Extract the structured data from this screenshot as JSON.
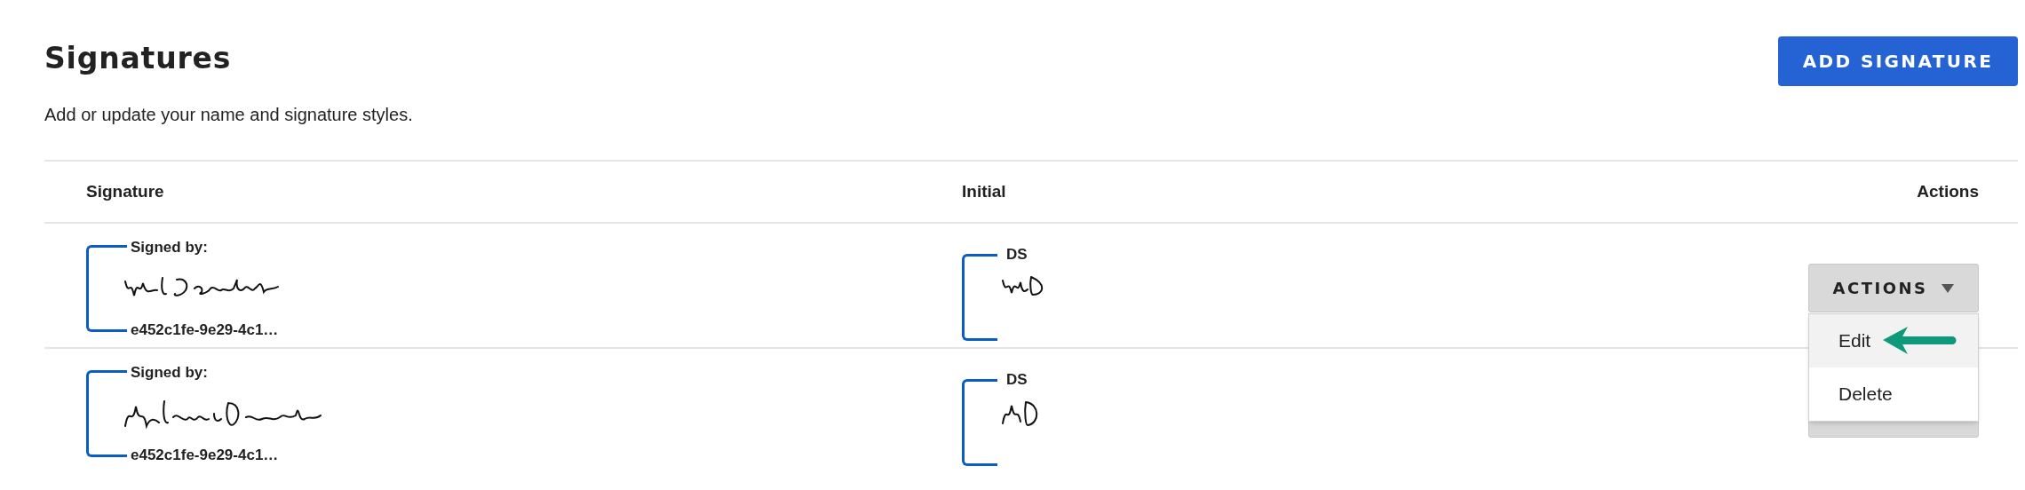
{
  "page": {
    "title": "Signatures",
    "subtitle": "Add or update your name and signature styles.",
    "add_button": "ADD SIGNATURE"
  },
  "table": {
    "columns": [
      "Signature",
      "Initial",
      "Actions"
    ],
    "rows": [
      {
        "signed_by_label": "Signed by:",
        "signature_id": "e452c1fe-9e29-4c1…",
        "initial_label": "DS",
        "actions_button": "ACTIONS",
        "menu": [
          {
            "label": "Edit",
            "selected": true
          },
          {
            "label": "Delete",
            "selected": false
          }
        ]
      },
      {
        "signed_by_label": "Signed by:",
        "signature_id": "e452c1fe-9e29-4c1…",
        "initial_label": "DS"
      }
    ]
  }
}
